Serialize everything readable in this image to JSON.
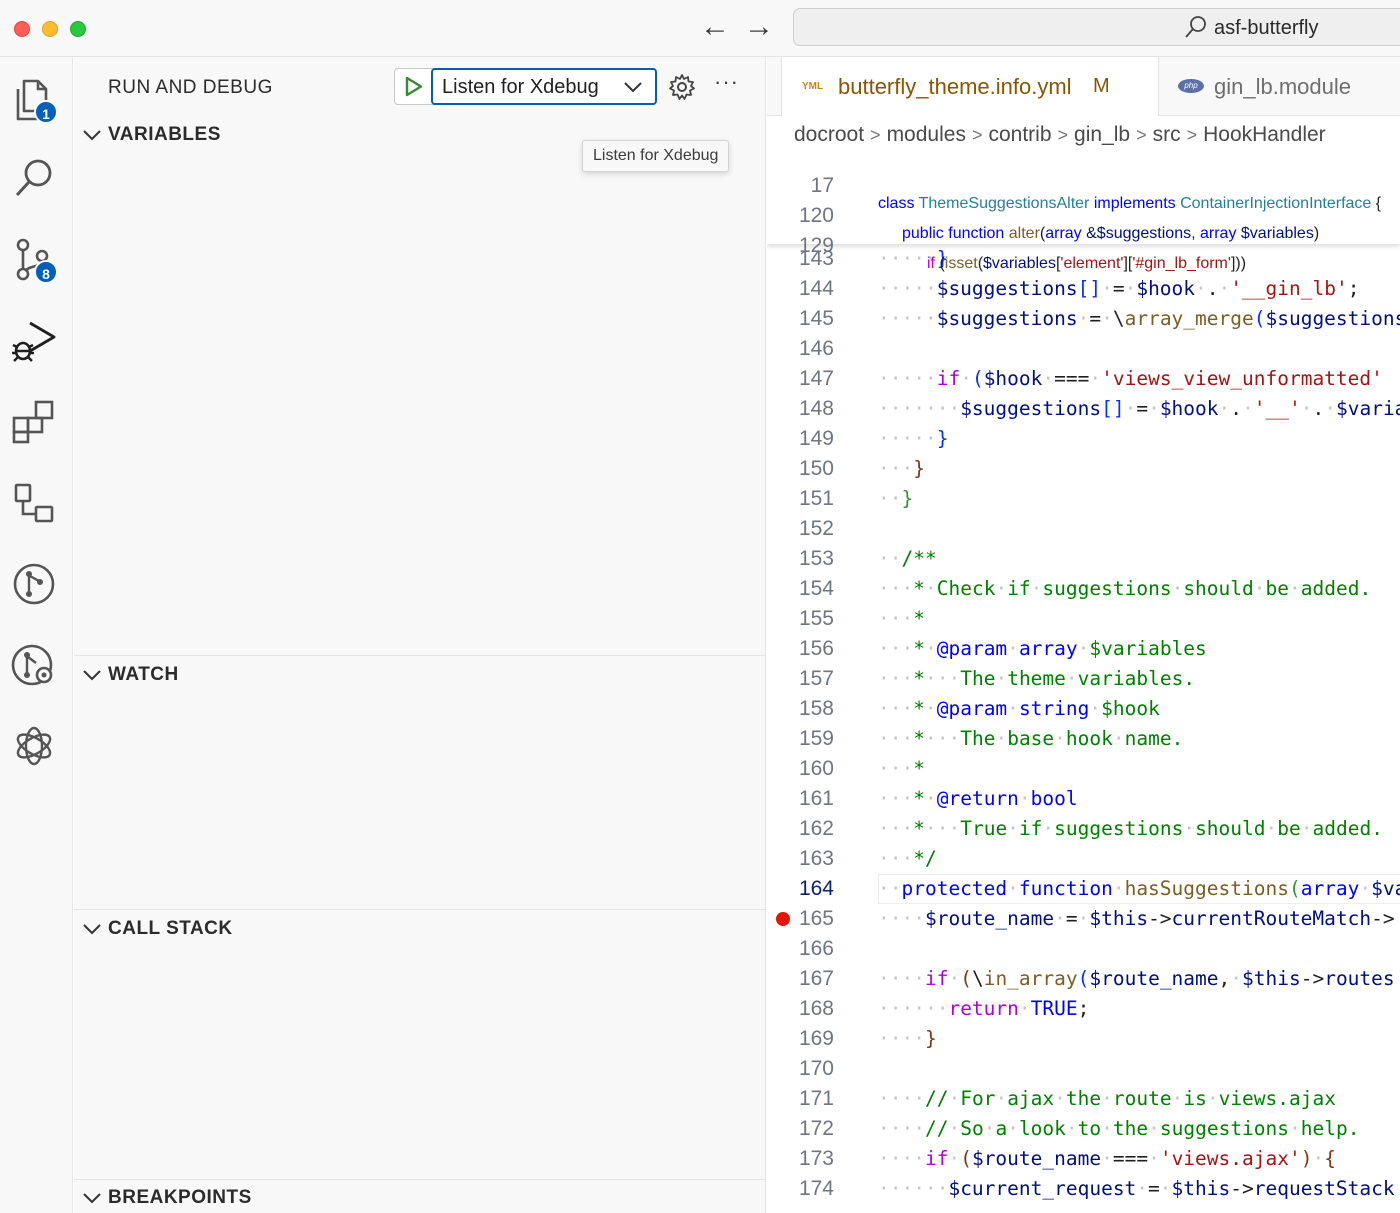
{
  "titlebar": {
    "back_icon": "arrow-left-icon",
    "forward_icon": "arrow-right-icon",
    "search_text": "asf-butterfly",
    "search_icon": "search-icon"
  },
  "activity_bar": {
    "items": [
      {
        "name": "explorer",
        "icon": "files-icon",
        "badge": "1"
      },
      {
        "name": "search",
        "icon": "search-icon",
        "badge": ""
      },
      {
        "name": "source-control",
        "icon": "source-control-icon",
        "badge": "8"
      },
      {
        "name": "run-and-debug",
        "icon": "run-debug-icon",
        "badge": ""
      },
      {
        "name": "extensions",
        "icon": "extensions-icon",
        "badge": ""
      },
      {
        "name": "remote-explorer",
        "icon": "remote-explorer-icon",
        "badge": ""
      },
      {
        "name": "gitlens",
        "icon": "git-graph-icon",
        "badge": ""
      },
      {
        "name": "gitlens-inspect",
        "icon": "git-inspect-icon",
        "badge": ""
      },
      {
        "name": "chatgpt",
        "icon": "openai-icon",
        "badge": ""
      }
    ]
  },
  "sidebar": {
    "title": "RUN AND DEBUG",
    "config_selected": "Listen for Xdebug",
    "tooltip": "Listen for Xdebug",
    "more_label": "···",
    "sections": {
      "variables": "VARIABLES",
      "watch": "WATCH",
      "call_stack": "CALL STACK",
      "breakpoints": "BREAKPOINTS"
    }
  },
  "editor": {
    "tabs": [
      {
        "label": "butterfly_theme.info.yml",
        "modified": "M",
        "icon": "yaml-file-icon",
        "active": true
      },
      {
        "label": "gin_lb.module",
        "modified": "",
        "icon": "php-file-icon",
        "active": false
      }
    ],
    "breadcrumb": [
      "docroot",
      "modules",
      "contrib",
      "gin_lb",
      "src",
      "HookHandler"
    ],
    "current_line": "164",
    "breakpoint_line": "165",
    "sticky_lines": [
      {
        "n": "17",
        "indent": 0
      },
      {
        "n": "120",
        "indent": 1
      },
      {
        "n": "129",
        "indent": 2
      }
    ],
    "lines": [
      {
        "n": "143"
      },
      {
        "n": "144"
      },
      {
        "n": "145"
      },
      {
        "n": "146"
      },
      {
        "n": "147"
      },
      {
        "n": "148"
      },
      {
        "n": "149"
      },
      {
        "n": "150"
      },
      {
        "n": "151"
      },
      {
        "n": "152"
      },
      {
        "n": "153"
      },
      {
        "n": "154"
      },
      {
        "n": "155"
      },
      {
        "n": "156"
      },
      {
        "n": "157"
      },
      {
        "n": "158"
      },
      {
        "n": "159"
      },
      {
        "n": "160"
      },
      {
        "n": "161"
      },
      {
        "n": "162"
      },
      {
        "n": "163"
      },
      {
        "n": "164"
      },
      {
        "n": "165"
      },
      {
        "n": "166"
      },
      {
        "n": "167"
      },
      {
        "n": "168"
      },
      {
        "n": "169"
      },
      {
        "n": "170"
      },
      {
        "n": "171"
      },
      {
        "n": "172"
      },
      {
        "n": "173"
      },
      {
        "n": "174"
      }
    ]
  },
  "colors": {
    "accent": "#005fb8",
    "breakpoint": "#e51400",
    "keyword": "#0000ff",
    "control_keyword": "#af00db",
    "string": "#a31515",
    "comment": "#008000",
    "variable": "#001080",
    "function": "#795e26",
    "class": "#267f99"
  }
}
